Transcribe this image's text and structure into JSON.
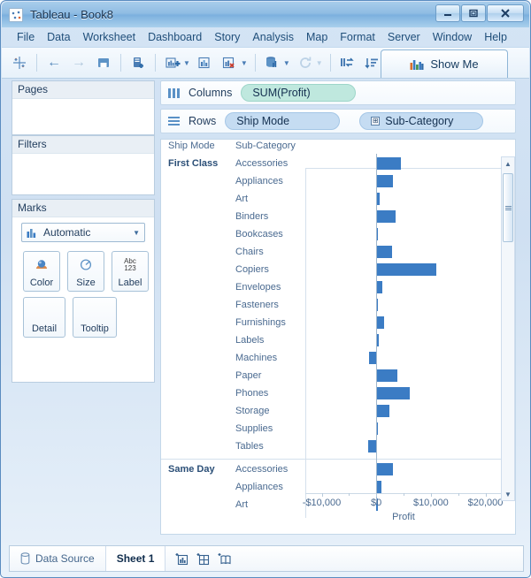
{
  "window": {
    "title": "Tableau - Book8",
    "icon": "tableau-logo-icon",
    "minimize_label": "–",
    "maximize_label": "□",
    "close_label": "✕"
  },
  "menubar": {
    "items": [
      "File",
      "Data",
      "Worksheet",
      "Dashboard",
      "Story",
      "Analysis",
      "Map",
      "Format",
      "Server",
      "Window",
      "Help"
    ]
  },
  "toolbar": {
    "show_me_label": "Show Me",
    "buttons": [
      {
        "name": "tableau-home-icon",
        "glyph": "✳"
      },
      {
        "name": "back-icon",
        "glyph": "←"
      },
      {
        "name": "forward-icon",
        "glyph": "→"
      },
      {
        "name": "save-icon",
        "glyph": "▤"
      },
      {
        "name": "new-data-source-icon",
        "glyph": "➕"
      },
      {
        "name": "new-worksheet-icon",
        "glyph": "+"
      },
      {
        "name": "duplicate-sheet-icon",
        "glyph": "⧉"
      },
      {
        "name": "clear-sheet-icon",
        "glyph": "✕"
      },
      {
        "name": "extract-icon",
        "glyph": "▥"
      },
      {
        "name": "refresh-icon",
        "glyph": "↻"
      },
      {
        "name": "swap-rows-columns-icon",
        "glyph": "⇄"
      },
      {
        "name": "sort-ascending-icon",
        "glyph": "↓"
      }
    ]
  },
  "left_panel": {
    "pages_title": "Pages",
    "filters_title": "Filters",
    "marks_title": "Marks",
    "marks_type": "Automatic",
    "marks_buttons": [
      {
        "label": "Color",
        "icon": "color-palette-icon"
      },
      {
        "label": "Size",
        "icon": "size-icon"
      },
      {
        "label": "Label",
        "icon": "abc123-label-icon"
      },
      {
        "label": "Detail",
        "icon": "detail-icon"
      },
      {
        "label": "Tooltip",
        "icon": "tooltip-icon"
      }
    ]
  },
  "shelves": {
    "columns_label": "Columns",
    "rows_label": "Rows",
    "columns_pills": [
      {
        "text": "SUM(Profit)",
        "type": "measure"
      }
    ],
    "rows_pills": [
      {
        "text": "Ship Mode",
        "type": "dimension",
        "expandable": false
      },
      {
        "text": "Sub-Category",
        "type": "dimension",
        "expandable": true,
        "expand_glyph": "⊞"
      }
    ]
  },
  "view": {
    "header_ship_mode": "Ship Mode",
    "header_sub_category": "Sub-Category"
  },
  "chart_data": {
    "type": "bar",
    "title": "",
    "orientation": "horizontal",
    "xlabel": "Profit",
    "ylabel": "",
    "xlim": [
      -13000,
      23000
    ],
    "xticks": [
      -10000,
      0,
      10000,
      20000
    ],
    "xtick_labels": [
      "-$10,000",
      "$0",
      "$10,000",
      "$20,000"
    ],
    "grid": false,
    "legend": "none",
    "groups": [
      {
        "name": "First Class",
        "categories": [
          "Accessories",
          "Appliances",
          "Art",
          "Binders",
          "Bookcases",
          "Chairs",
          "Copiers",
          "Envelopes",
          "Fasteners",
          "Furnishings",
          "Labels",
          "Machines",
          "Paper",
          "Phones",
          "Storage",
          "Supplies",
          "Tables"
        ],
        "values": [
          4500,
          3000,
          700,
          3500,
          150,
          2900,
          11000,
          1100,
          100,
          1400,
          500,
          -1300,
          3900,
          6100,
          2400,
          60,
          -1500
        ]
      },
      {
        "name": "Same Day",
        "categories": [
          "Accessories",
          "Appliances",
          "Art"
        ],
        "values": [
          3100,
          900,
          20
        ]
      }
    ]
  },
  "scrollbar": {
    "up_glyph": "▲",
    "down_glyph": "▼"
  },
  "statusbar": {
    "data_source_label": "Data Source",
    "active_sheet_label": "Sheet 1",
    "tabs_icons": [
      {
        "name": "new-worksheet-icon"
      },
      {
        "name": "new-dashboard-icon"
      },
      {
        "name": "new-story-icon"
      }
    ]
  }
}
